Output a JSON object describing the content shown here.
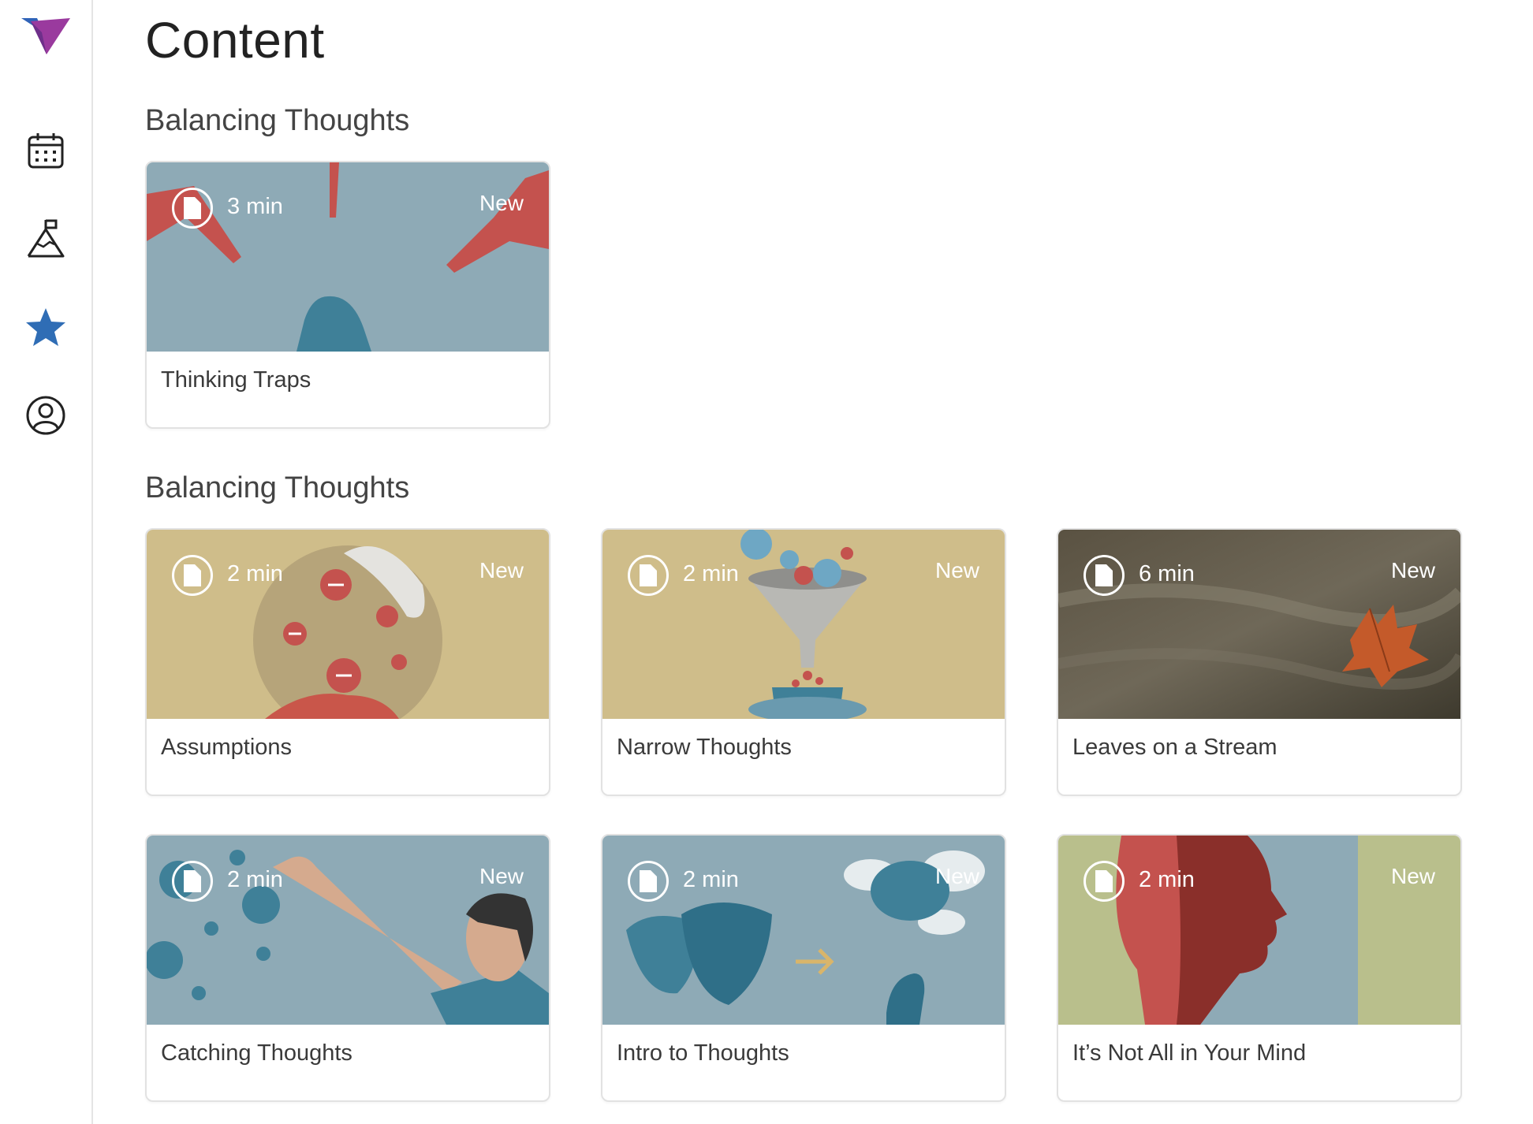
{
  "page": {
    "title": "Content"
  },
  "sidebar": {
    "items": [
      {
        "name": "calendar",
        "icon": "calendar-icon"
      },
      {
        "name": "goals",
        "icon": "mountain-flag-icon"
      },
      {
        "name": "favorites",
        "icon": "star-icon",
        "active": true
      },
      {
        "name": "profile",
        "icon": "user-icon"
      }
    ],
    "accent": "#2f6db5"
  },
  "sections": [
    {
      "title": "Balancing Thoughts",
      "cards": [
        {
          "title": "Thinking Traps",
          "duration": "3 min",
          "tag": "New",
          "bg": "#8eaab6"
        }
      ]
    },
    {
      "title": "Balancing Thoughts",
      "cards": [
        {
          "title": "Assumptions",
          "duration": "2 min",
          "tag": "New",
          "bg": "#cfbd8a"
        },
        {
          "title": "Narrow Thoughts",
          "duration": "2 min",
          "tag": "New",
          "bg": "#cfbd8a"
        },
        {
          "title": "Leaves on a Stream",
          "duration": "6 min",
          "tag": "New",
          "bg": "#4f4a3c"
        },
        {
          "title": "Catching Thoughts",
          "duration": "2 min",
          "tag": "New",
          "bg": "#8eaab6"
        },
        {
          "title": "Intro to Thoughts",
          "duration": "2 min",
          "tag": "New",
          "bg": "#8eaab6"
        },
        {
          "title": "It’s Not All in Your Mind",
          "duration": "2 min",
          "tag": "New",
          "bg": "#b9bf8c"
        }
      ]
    }
  ]
}
